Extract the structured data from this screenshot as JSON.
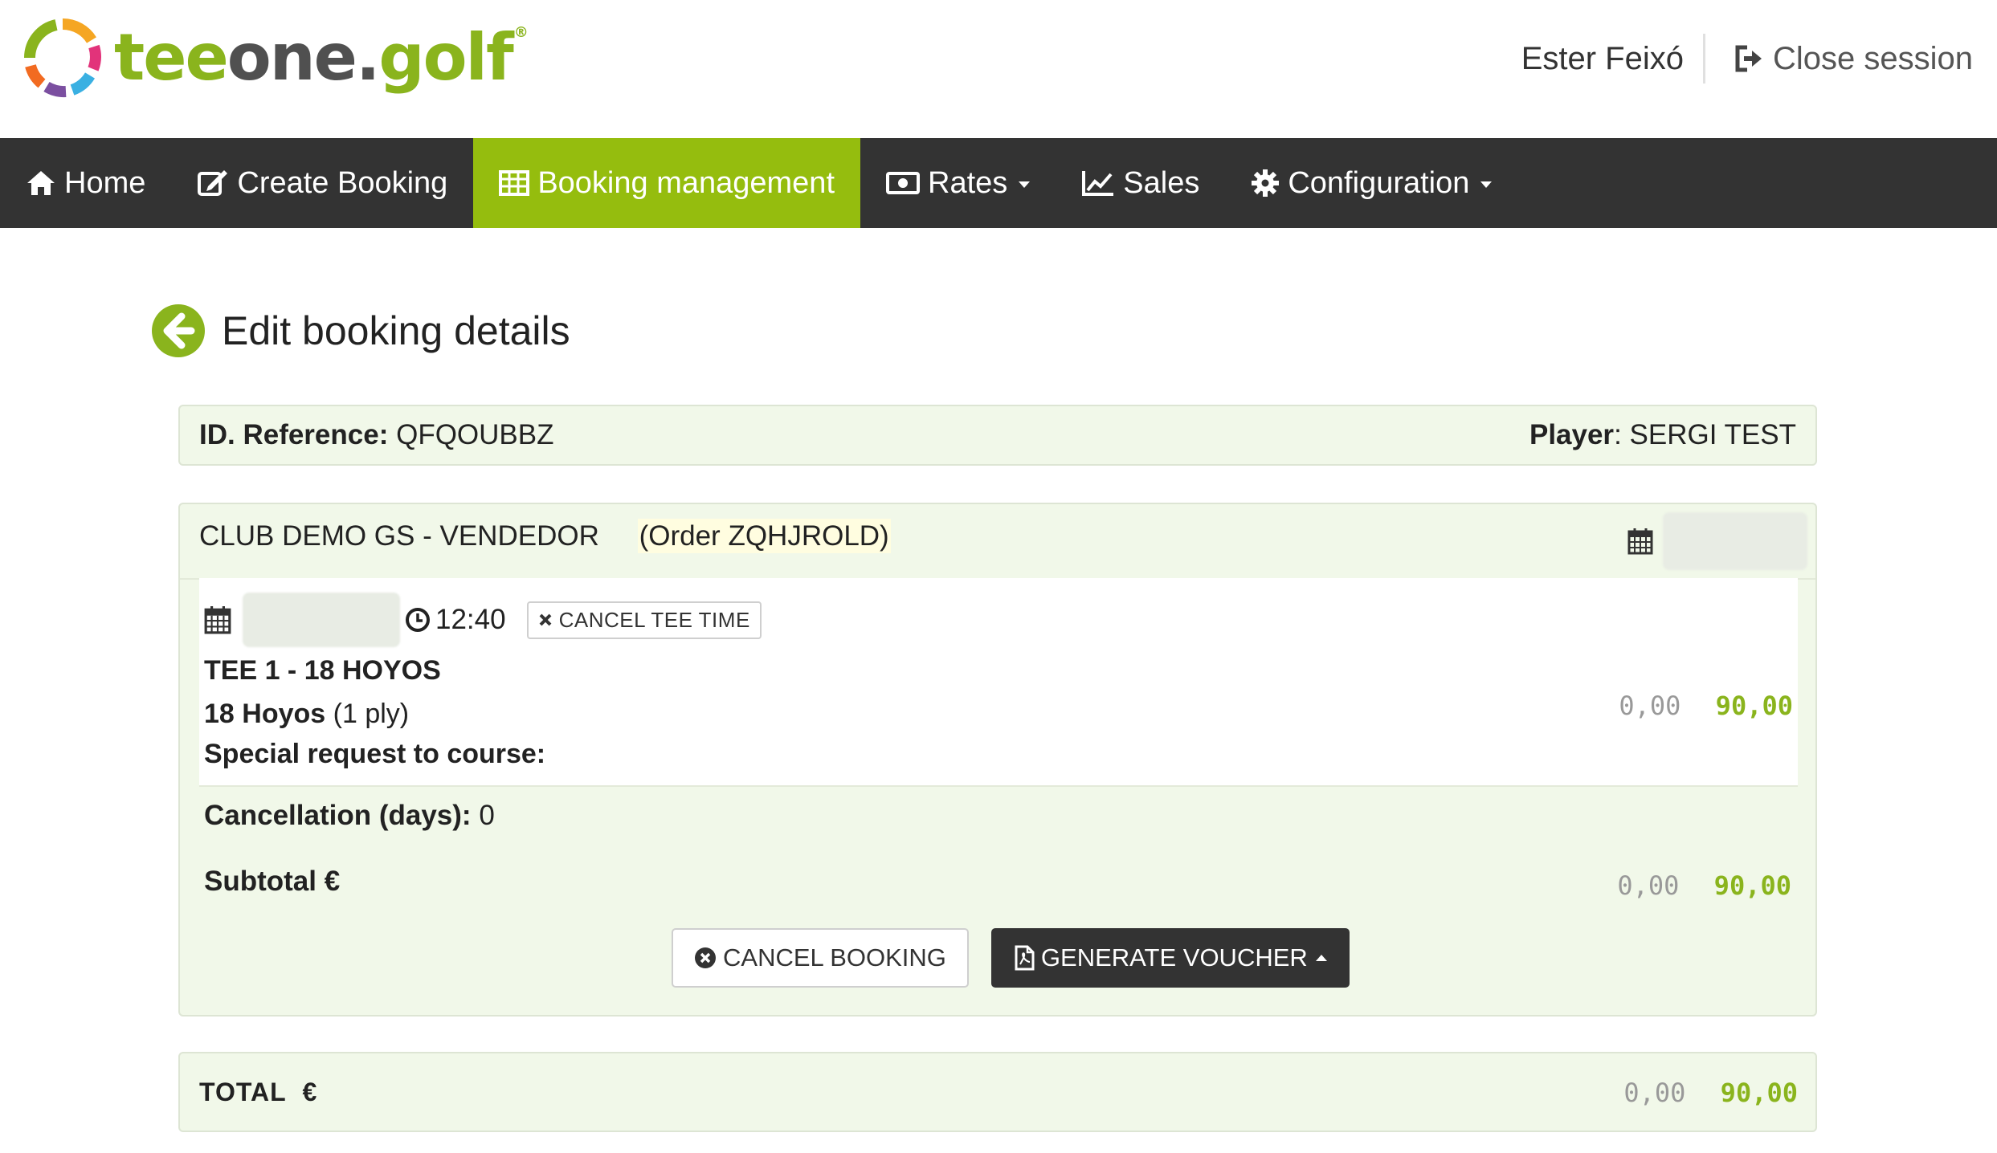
{
  "header": {
    "logo": {
      "part1": "tee",
      "part2": "one",
      "part3": ".",
      "part4": "golf",
      "reg": "®"
    },
    "user_name": "Ester Feixó",
    "logout_label": "Close session"
  },
  "nav": {
    "home": "Home",
    "create_booking": "Create Booking",
    "booking_management": "Booking management",
    "rates": "Rates",
    "sales": "Sales",
    "configuration": "Configuration"
  },
  "page": {
    "title": "Edit booking details"
  },
  "reference": {
    "id_label": "ID. Reference:",
    "id_value": "QFQOUBBZ",
    "player_label": "Player",
    "player_sep": ":",
    "player_value": "SERGI TEST"
  },
  "club": {
    "name": "CLUB DEMO GS - VENDEDOR",
    "order": "(Order ZQHJROLD)",
    "tee_time": {
      "time": "12:40",
      "cancel_label": "CANCEL TEE TIME",
      "course": "TEE 1 - 18 HOYOS",
      "rate_name": "18 Hoyos",
      "rate_players": "(1 ply)",
      "special_request_label": "Special request to course:",
      "price_old": "0,00",
      "price_new": "90,00"
    },
    "cancellation_label": "Cancellation (days):",
    "cancellation_value": "0",
    "subtotal_label": "Subtotal €",
    "subtotal_old": "0,00",
    "subtotal_new": "90,00",
    "cancel_booking_label": "CANCEL BOOKING",
    "generate_voucher_label": "GENERATE VOUCHER"
  },
  "total": {
    "label": "TOTAL",
    "currency": "€",
    "old": "0,00",
    "new": "90,00"
  },
  "colors": {
    "brand_green": "#95bd0e",
    "nav_dark": "#333333",
    "panel_bg": "#f1f8e9"
  }
}
